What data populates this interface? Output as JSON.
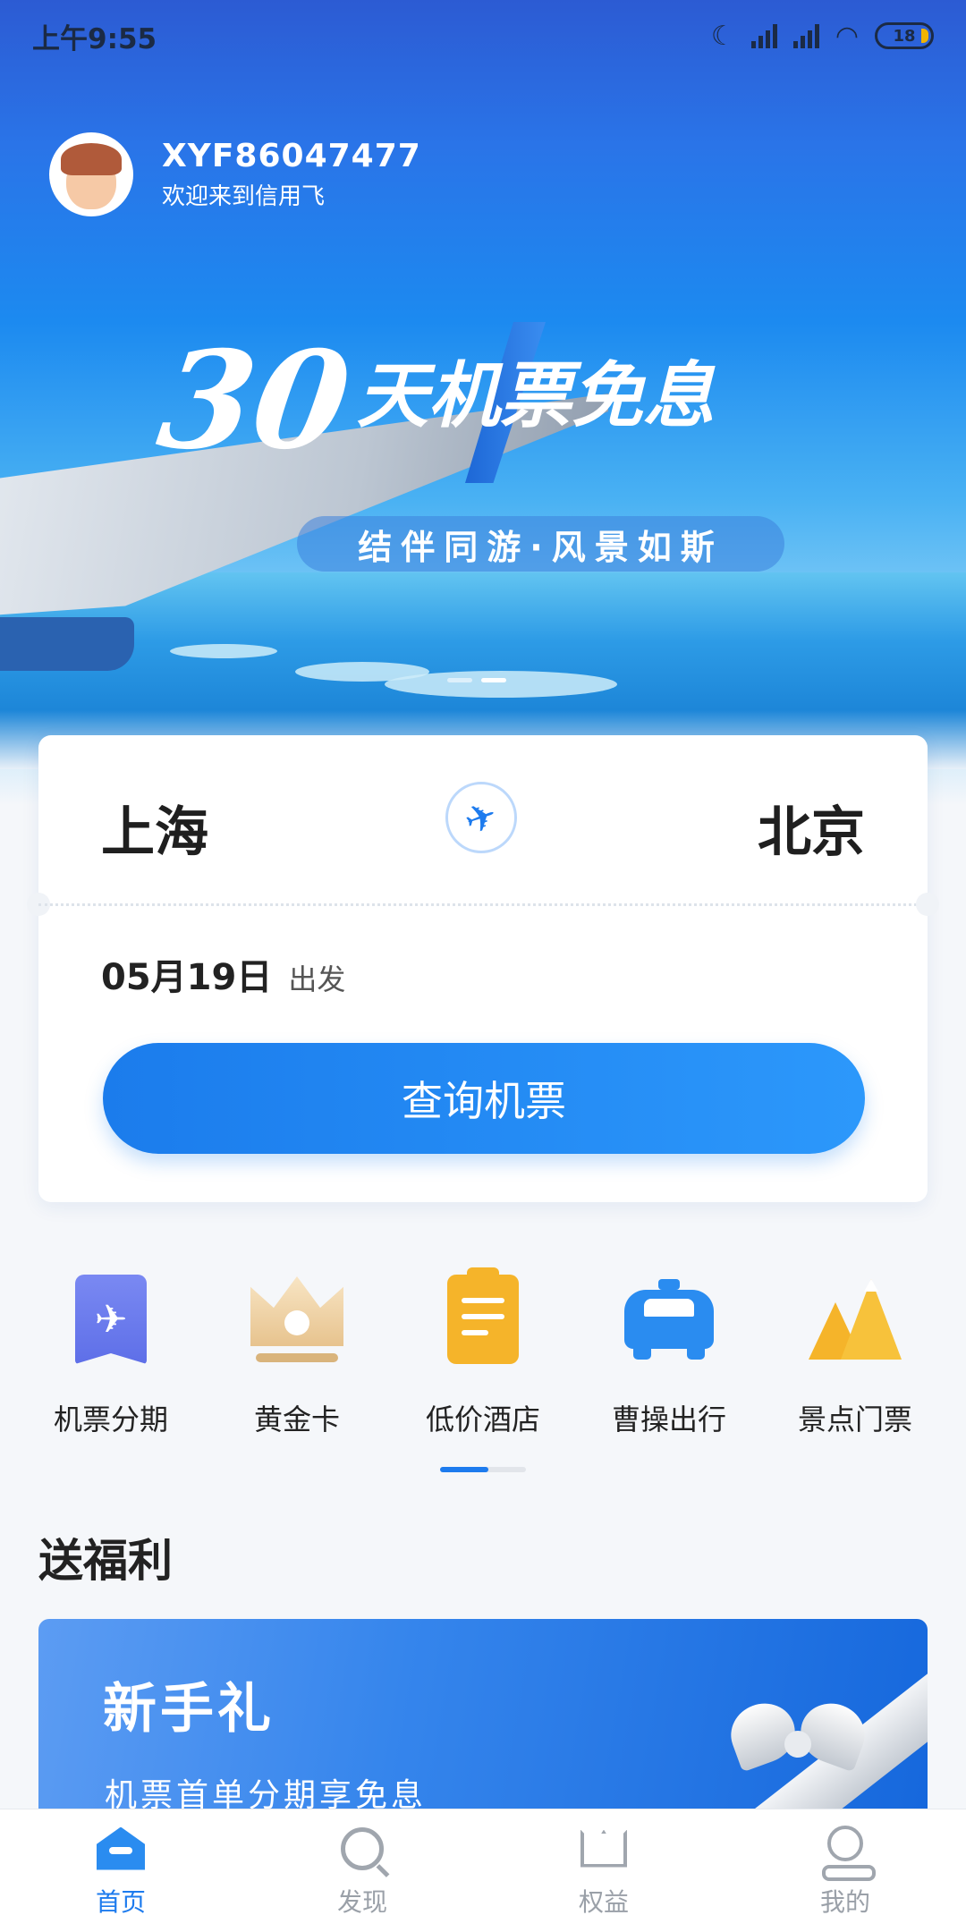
{
  "status_bar": {
    "time": "上午9:55",
    "battery": "18"
  },
  "user": {
    "username": "XYF86047477",
    "welcome": "欢迎来到信用飞"
  },
  "banner": {
    "headline_big": "30",
    "headline_rest": "天机票免息",
    "subline": "结伴同游·风景如斯",
    "slide_count": 2,
    "active_slide": 1
  },
  "search": {
    "from_city": "上海",
    "to_city": "北京",
    "date": "05月19日",
    "date_suffix": "出发",
    "query_button": "查询机票"
  },
  "quick_entries": [
    {
      "label": "机票分期",
      "icon": "ticket-plane-icon",
      "color": "#6c7cf0"
    },
    {
      "label": "黄金卡",
      "icon": "crown-icon",
      "color": "#e7c38e"
    },
    {
      "label": "低价酒店",
      "icon": "clipboard-check-icon",
      "color": "#f5b42a"
    },
    {
      "label": "曹操出行",
      "icon": "car-icon",
      "color": "#2a8cf0"
    },
    {
      "label": "景点门票",
      "icon": "mountain-icon",
      "color": "#f5b42a"
    }
  ],
  "benefits": {
    "section_title": "送福利",
    "promo_title": "新手礼",
    "promo_subtitle": "机票首单分期享免息"
  },
  "bottom_nav": [
    {
      "label": "首页",
      "icon": "home-icon",
      "active": true
    },
    {
      "label": "发现",
      "icon": "search-icon",
      "active": false
    },
    {
      "label": "权益",
      "icon": "crown-icon",
      "active": false
    },
    {
      "label": "我的",
      "icon": "user-icon",
      "active": false
    }
  ],
  "colors": {
    "accent": "#1d7bee",
    "inactive": "#9aa0a8"
  }
}
